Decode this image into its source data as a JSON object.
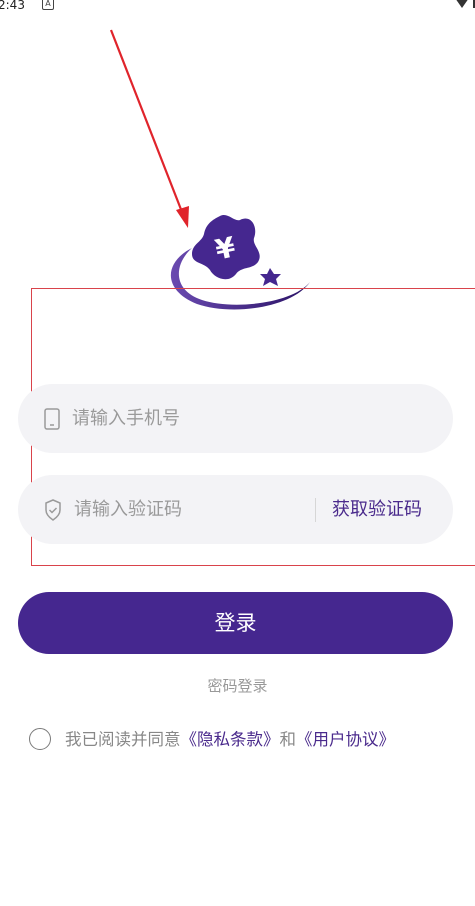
{
  "status_bar": {
    "time": "2:43",
    "notification_icon": "a-notification-icon",
    "signal_icon": "wifi-icon"
  },
  "logo": {
    "symbol": "¥",
    "icon": "yen-star-logo-icon"
  },
  "annotation": {
    "arrow_color": "#e0242b",
    "box_color": "#d9434b"
  },
  "phone_input": {
    "icon": "phone-icon",
    "placeholder": "请输入手机号"
  },
  "code_input": {
    "icon": "shield-icon",
    "placeholder": "请输入验证码",
    "get_code_label": "获取验证码"
  },
  "login": {
    "label": "登录"
  },
  "password_login": {
    "label": "密码登录"
  },
  "agreement": {
    "prefix": "我已阅读并同意",
    "privacy_link": "《隐私条款》",
    "conjunction": "和",
    "user_link": "《用户协议》"
  },
  "colors": {
    "brand": "#45278f",
    "input_bg": "#f3f3f6",
    "link": "#4a2a8c"
  }
}
